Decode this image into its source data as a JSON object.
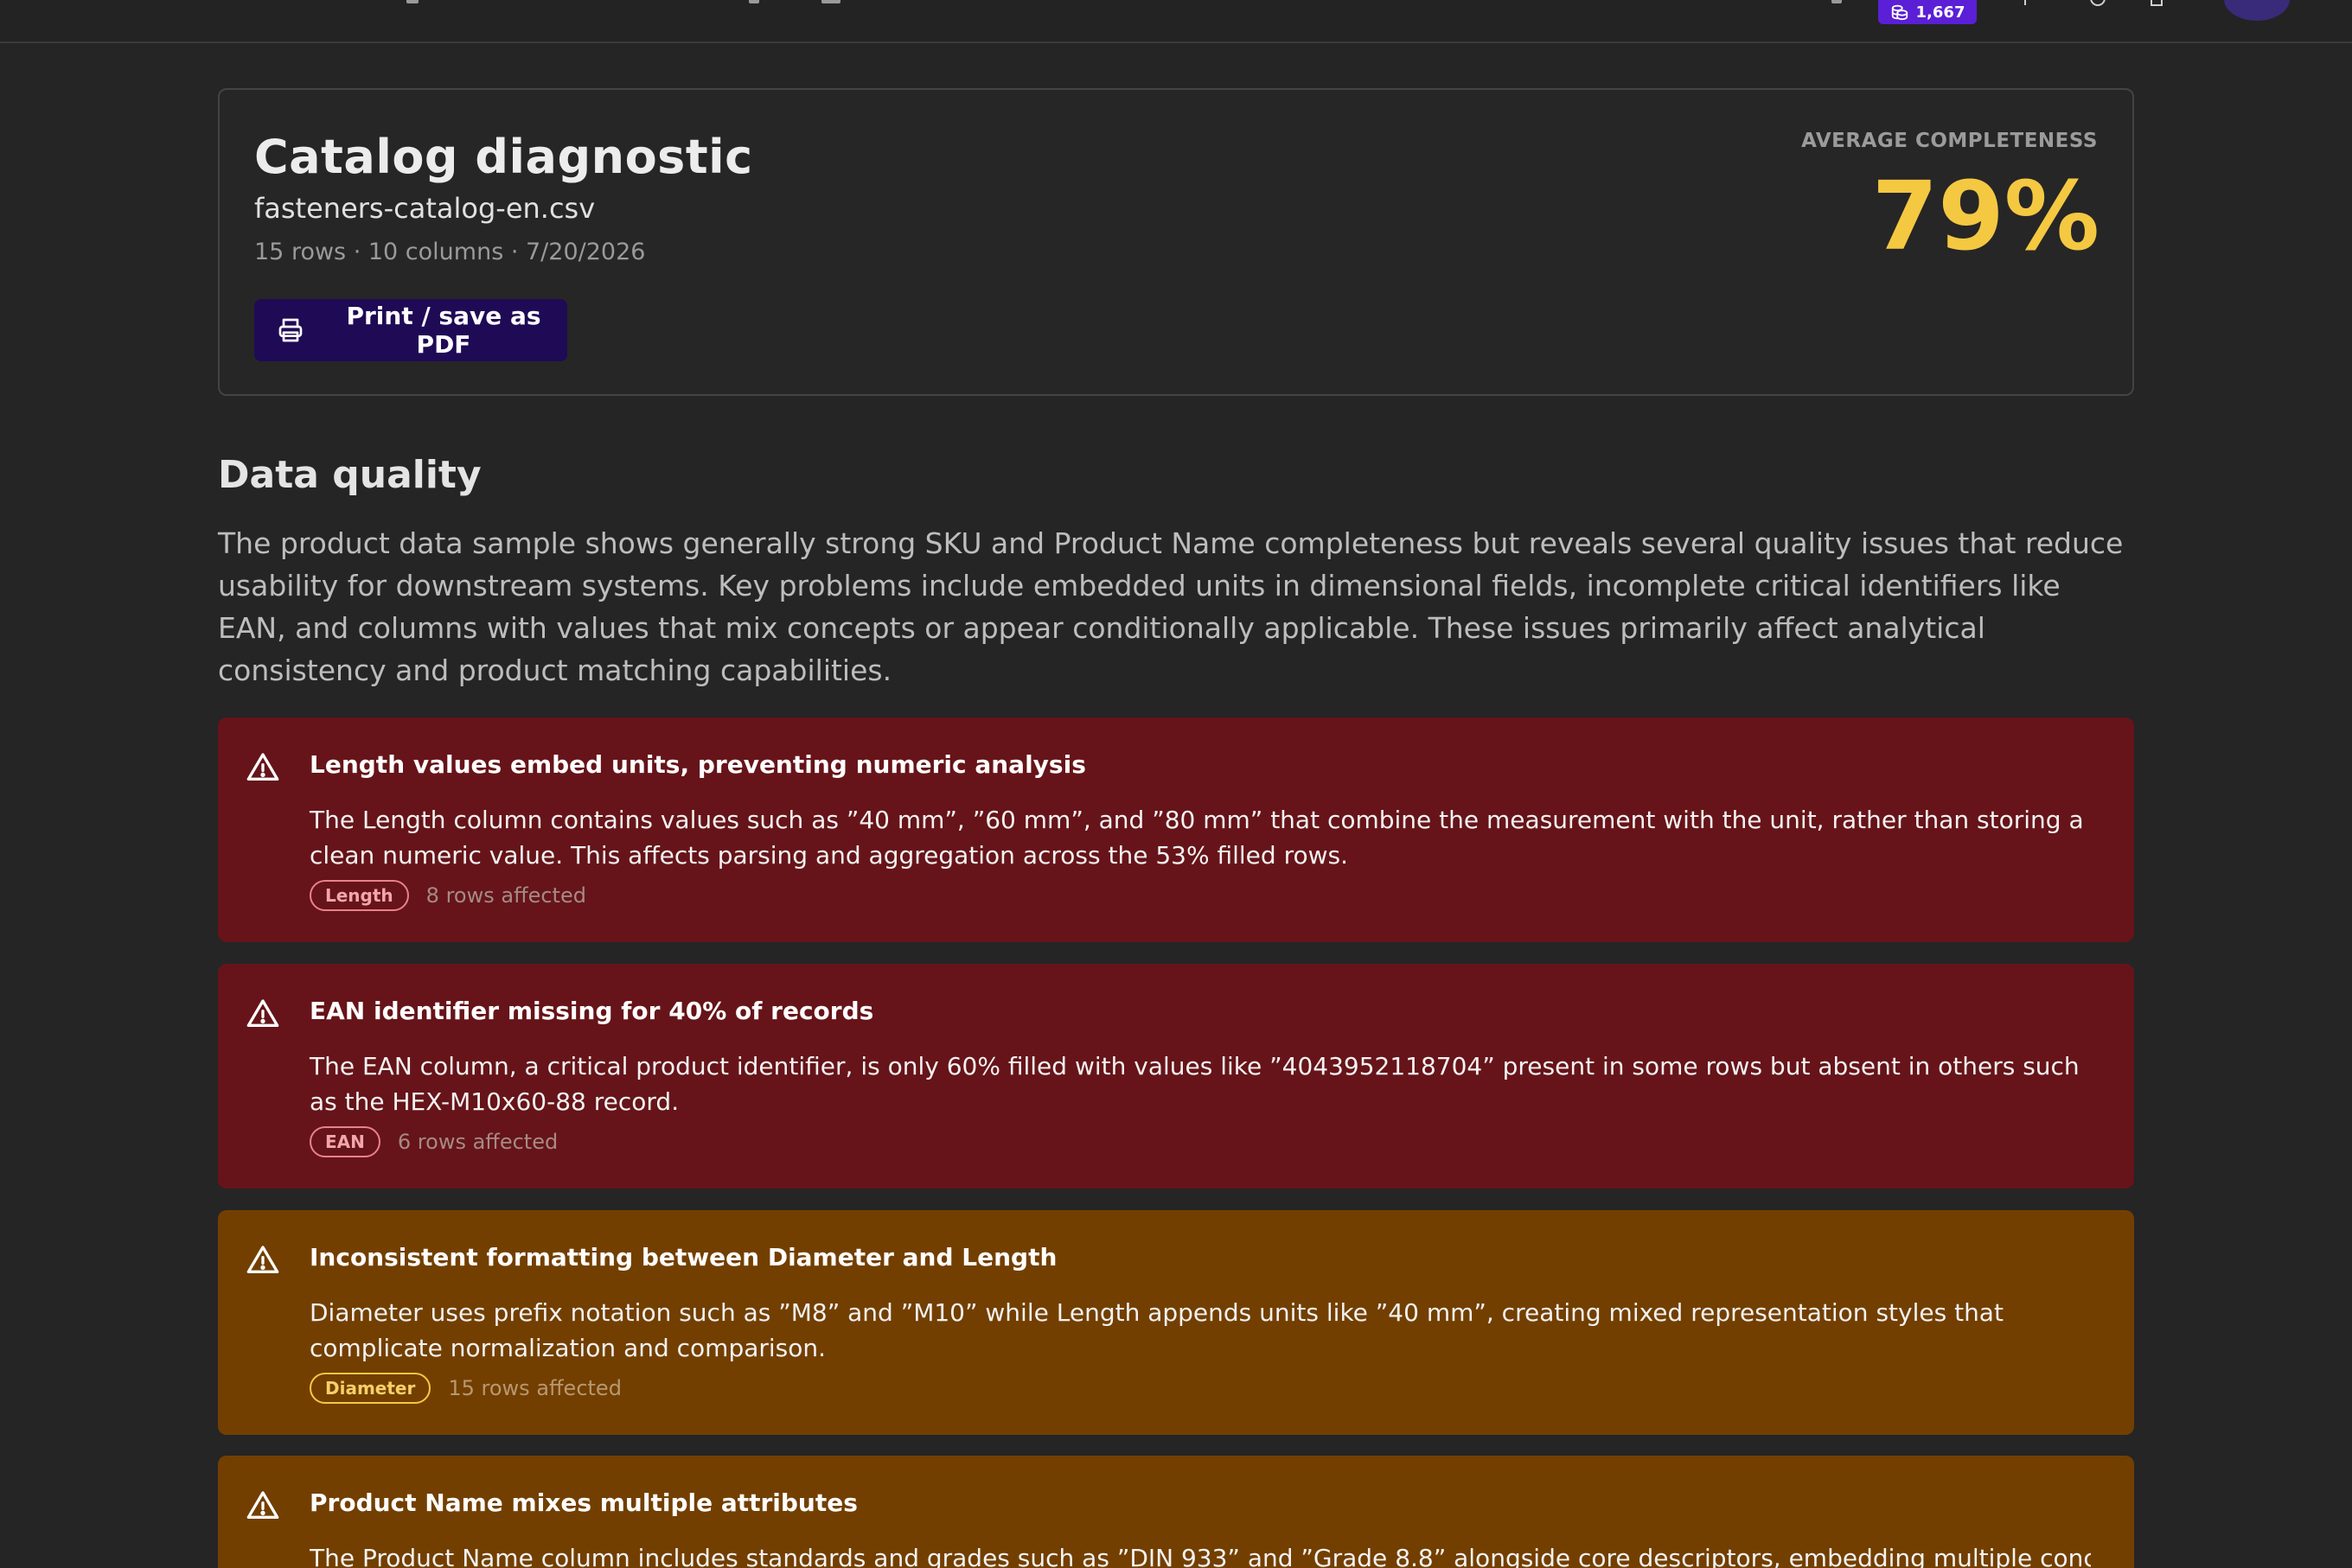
{
  "topbar": {
    "credits": "1,667",
    "colors": {
      "credits_bg": "#5b1fd6"
    }
  },
  "report": {
    "title": "Catalog diagnostic",
    "file_name": "fasteners-catalog-en.csv",
    "meta": "15 rows · 10 columns · 7/20/2026",
    "print_label": "Print / save as PDF",
    "completeness_label": "AVERAGE COMPLETENESS",
    "completeness_value": "79%",
    "colors": {
      "completeness": "#f5c842",
      "button_bg": "#1f0a55"
    }
  },
  "quality": {
    "title": "Data quality",
    "summary": "The product data sample shows generally strong SKU and Product Name completeness but reveals several quality issues that reduce usability for downstream systems. Key problems include embedded units in dimensional fields, incomplete critical identifiers like EAN, and columns with values that mix concepts or appear conditionally applicable. These issues primarily affect analytical consistency and product matching capabilities.",
    "issues": [
      {
        "severity": "high",
        "icon": "warning-triangle-icon",
        "title": "Length values embed units, preventing numeric analysis",
        "description": "The Length column contains values such as ”40 mm”, ”60 mm”, and ”80 mm” that combine the measurement with the unit, rather than storing a clean numeric value. This affects parsing and aggregation across the 53% filled rows.",
        "tag": "Length",
        "rows": "8 rows affected"
      },
      {
        "severity": "high",
        "icon": "warning-triangle-icon",
        "title": "EAN identifier missing for 40% of records",
        "description": "The EAN column, a critical product identifier, is only 60% filled with values like ”4043952118704” present in some rows but absent in others such as the HEX-M10x60-88 record.",
        "tag": "EAN",
        "rows": "6 rows affected"
      },
      {
        "severity": "medium",
        "icon": "warning-triangle-icon",
        "title": "Inconsistent formatting between Diameter and Length",
        "description": "Diameter uses prefix notation such as ”M8” and ”M10” while Length appends units like ”40 mm”, creating mixed representation styles that complicate normalization and comparison.",
        "tag": "Diameter",
        "rows": "15 rows affected"
      },
      {
        "severity": "medium",
        "icon": "warning-triangle-icon",
        "title": "Product Name mixes multiple attributes",
        "description": "The Product Name column includes standards and grades such as ”DIN 933” and ”Grade 8.8” alongside core descriptors, embedding multiple concepts",
        "tag": "",
        "rows": ""
      }
    ],
    "colors": {
      "high_bg": "#661419",
      "medium_bg": "#733f00"
    }
  }
}
